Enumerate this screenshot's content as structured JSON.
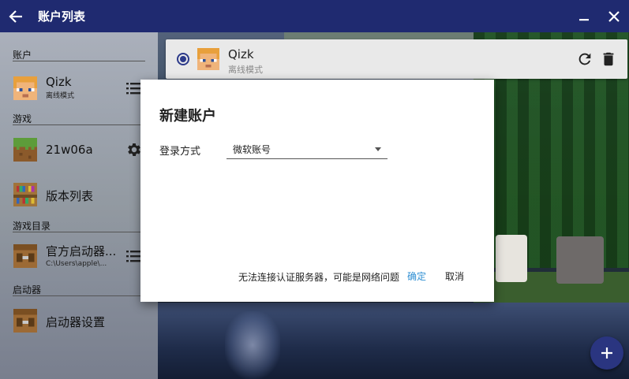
{
  "window": {
    "title": "账户列表"
  },
  "sidebar": {
    "sections": {
      "account": "账户",
      "game": "游戏",
      "game_dir": "游戏目录",
      "launcher": "启动器"
    },
    "account_item": {
      "name": "Qizk",
      "mode": "离线模式",
      "icon": "steve-head-icon",
      "action_icon": "list-icon"
    },
    "game_item": {
      "name": "21w06a",
      "icon": "grass-block-icon",
      "action_icon": "gear-icon"
    },
    "versions_item": {
      "name": "版本列表",
      "icon": "bookshelf-icon"
    },
    "dir_item": {
      "name": "官方启动器...",
      "path": "C:\\Users\\apple\\...",
      "icon": "crafting-table-icon",
      "action_icon": "list-icon"
    },
    "settings_item": {
      "name": "启动器设置",
      "icon": "crafting-table-icon"
    }
  },
  "account_card": {
    "name": "Qizk",
    "mode": "离线模式",
    "selected": true
  },
  "dialog": {
    "title": "新建账户",
    "login_label": "登录方式",
    "login_value": "微软账号",
    "error": "无法连接认证服务器，可能是网络问题",
    "ok_label": "确定",
    "cancel_label": "取消"
  },
  "colors": {
    "titlebar": "#1f2a70",
    "accent": "#2f8fd3",
    "fab": "#2a3580"
  }
}
